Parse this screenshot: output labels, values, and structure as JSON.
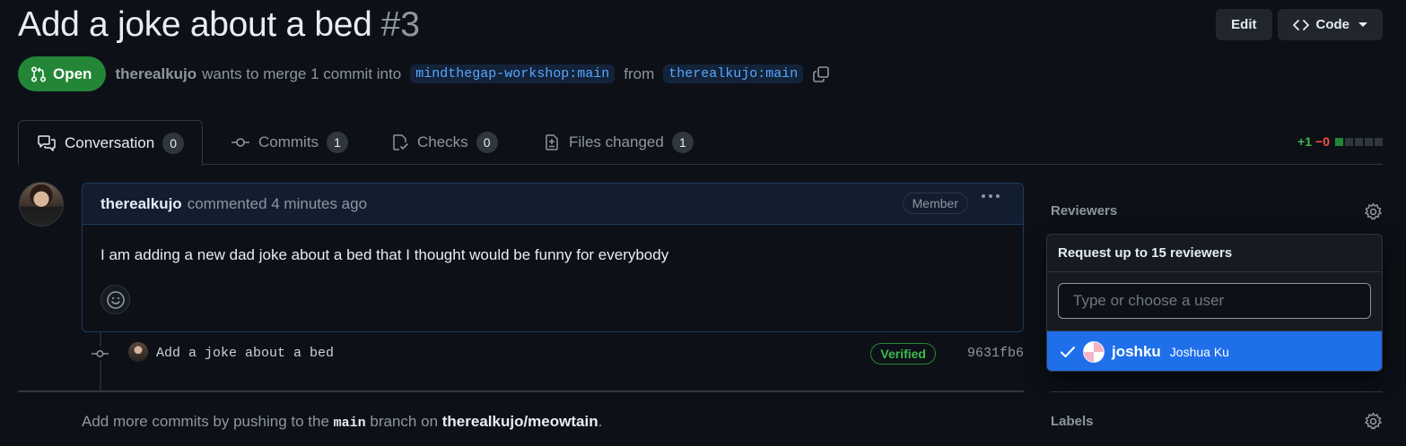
{
  "pr": {
    "title": "Add a joke about a bed",
    "number": "#3",
    "state": "Open",
    "author": "therealkujo",
    "merge_text": "wants to merge 1 commit into",
    "base_branch": "mindthegap-workshop:main",
    "from_text": "from",
    "head_branch": "therealkujo:main"
  },
  "header_actions": {
    "edit_label": "Edit",
    "code_label": "Code"
  },
  "tabs": [
    {
      "label": "Conversation",
      "count": "0",
      "icon": "comment-discussion-icon",
      "selected": true
    },
    {
      "label": "Commits",
      "count": "1",
      "icon": "git-commit-icon",
      "selected": false
    },
    {
      "label": "Checks",
      "count": "0",
      "icon": "checklist-icon",
      "selected": false
    },
    {
      "label": "Files changed",
      "count": "1",
      "icon": "file-diff-icon",
      "selected": false
    }
  ],
  "diffstat": {
    "additions": "+1",
    "deletions": "−0",
    "colors": {
      "add": "#3fb950",
      "del": "#f85149"
    }
  },
  "comment": {
    "author": "therealkujo",
    "action": "commented 4 minutes ago",
    "role_badge": "Member",
    "body": "I am adding a new dad joke about a bed that I thought would be funny for everybody"
  },
  "commit": {
    "message": "Add a joke about a bed",
    "verified_label": "Verified",
    "sha": "9631fb6"
  },
  "footer": {
    "prefix": "Add more commits by pushing to the",
    "branch": "main",
    "middle": "branch on",
    "repo": "therealkujo/meowtain",
    "suffix": "."
  },
  "sidebar": {
    "reviewers_heading": "Reviewers",
    "labels_heading": "Labels",
    "reviewer_dropdown": {
      "header": "Request up to 15 reviewers",
      "placeholder": "Type or choose a user",
      "users": [
        {
          "login": "joshku",
          "name": "Joshua Ku",
          "selected": true
        }
      ]
    }
  },
  "colors": {
    "background": "#0d1117",
    "open_green": "#238636",
    "link_blue": "#58a6ff",
    "selected_blue": "#1f6feb"
  }
}
